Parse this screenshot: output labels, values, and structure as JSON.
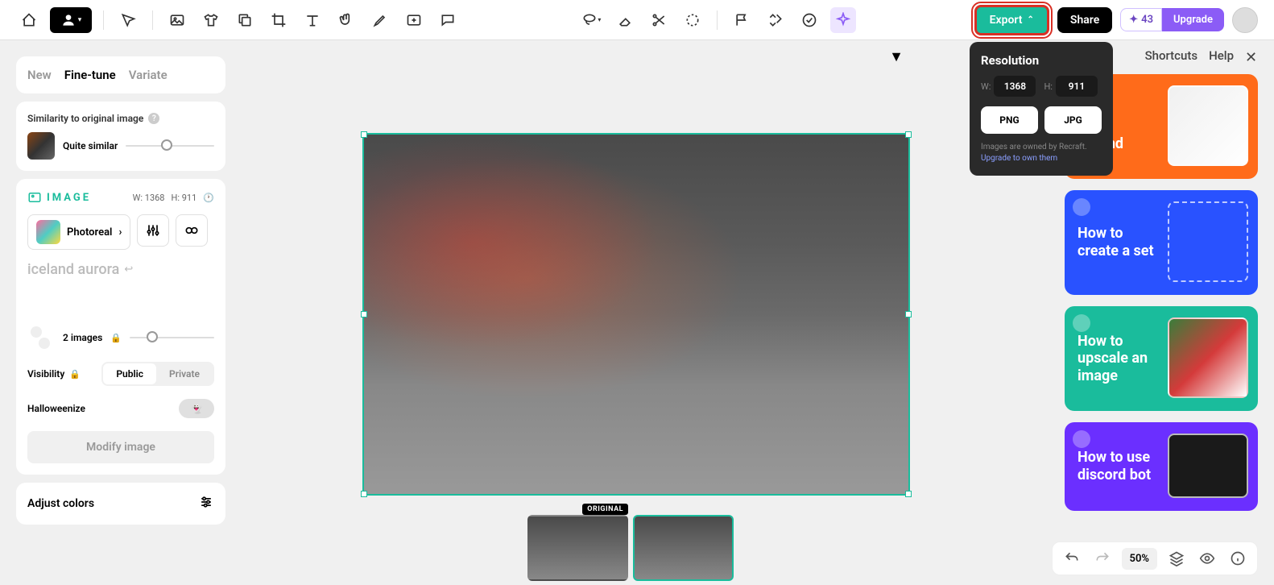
{
  "toolbar": {
    "export": "Export",
    "share": "Share",
    "credits": "43",
    "upgrade": "Upgrade"
  },
  "export_popup": {
    "title": "Resolution",
    "w_label": "W:",
    "h_label": "H:",
    "width": "1368",
    "height": "911",
    "png": "PNG",
    "jpg": "JPG",
    "owned_text": "Images are owned by Recraft.",
    "upgrade_link": "Upgrade to own them"
  },
  "tabs": {
    "new": "New",
    "fine_tune": "Fine-tune",
    "variate": "Variate"
  },
  "similarity": {
    "label": "Similarity to original image",
    "value": "Quite similar"
  },
  "image_panel": {
    "title": "IMAGE",
    "w_label": "W:",
    "w_value": "1368",
    "h_label": "H:",
    "h_value": "911",
    "style": "Photoreal",
    "prompt": "iceland aurora",
    "images_count": "2 images",
    "visibility_label": "Visibility",
    "public": "Public",
    "private": "Private",
    "halloweenize": "Halloweenize",
    "modify": "Modify image"
  },
  "adjust_colors": "Adjust colors",
  "thumbnails": {
    "original_tag": "ORIGINAL"
  },
  "right_header": {
    "shortcuts": "Shortcuts",
    "help": "Help"
  },
  "cards": {
    "orange": "to\nove\nground",
    "blue": "How to create a set",
    "teal": "How to upscale an image",
    "purple": "How to use discord bot"
  },
  "bottombar": {
    "zoom": "50%"
  }
}
